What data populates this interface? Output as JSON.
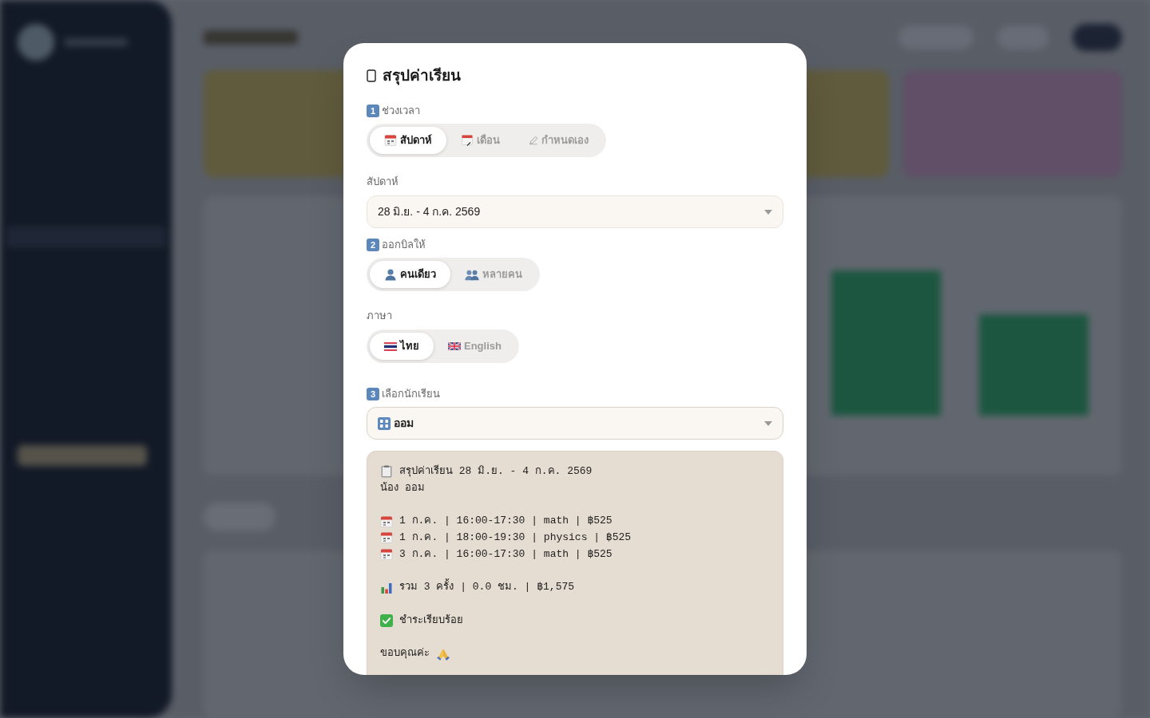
{
  "dialog": {
    "title": "สรุปค่าเรียน"
  },
  "period": {
    "step": "1",
    "label": "ช่วงเวลา",
    "options": [
      {
        "kind": "week",
        "label": "สัปดาห์",
        "selected": true
      },
      {
        "kind": "month",
        "label": "เดือน",
        "selected": false
      },
      {
        "kind": "custom",
        "label": "กำหนดเอง",
        "selected": false
      }
    ]
  },
  "week_select": {
    "label": "สัปดาห์",
    "value": "28 มิ.ย. - 4 ก.ค. 2569"
  },
  "bill_to": {
    "step": "2",
    "label": "ออกบิลให้",
    "options": [
      {
        "kind": "single",
        "label": "คนเดียว",
        "selected": true
      },
      {
        "kind": "multiple",
        "label": "หลายคน",
        "selected": false
      }
    ]
  },
  "language": {
    "label": "ภาษา",
    "options": [
      {
        "kind": "th",
        "label": "ไทย",
        "selected": true
      },
      {
        "kind": "en",
        "label": "English",
        "selected": false
      }
    ]
  },
  "student_select": {
    "step": "3",
    "label": "เลือกนักเรียน",
    "value": "ออม"
  },
  "summary": {
    "lines": [
      {
        "kind": "heading",
        "text": "สรุปค่าเรียน 28 มิ.ย. - 4 ก.ค. 2569"
      },
      {
        "kind": "plain",
        "text": "น้อง ออม"
      },
      {
        "kind": "blank"
      },
      {
        "kind": "session",
        "text": "1 ก.ค. | 16:00-17:30 | math | ฿525"
      },
      {
        "kind": "session",
        "text": "1 ก.ค. | 18:00-19:30 | physics | ฿525"
      },
      {
        "kind": "session",
        "text": "3 ก.ค. | 16:00-17:30 | math | ฿525"
      },
      {
        "kind": "blank"
      },
      {
        "kind": "total",
        "text": "รวม 3 ครั้ง | 0.0 ชม. | ฿1,575"
      },
      {
        "kind": "blank"
      },
      {
        "kind": "paid",
        "text": "ชำระเรียบร้อย"
      },
      {
        "kind": "blank"
      },
      {
        "kind": "thanks",
        "text": "ขอบคุณค่ะ"
      }
    ]
  }
}
